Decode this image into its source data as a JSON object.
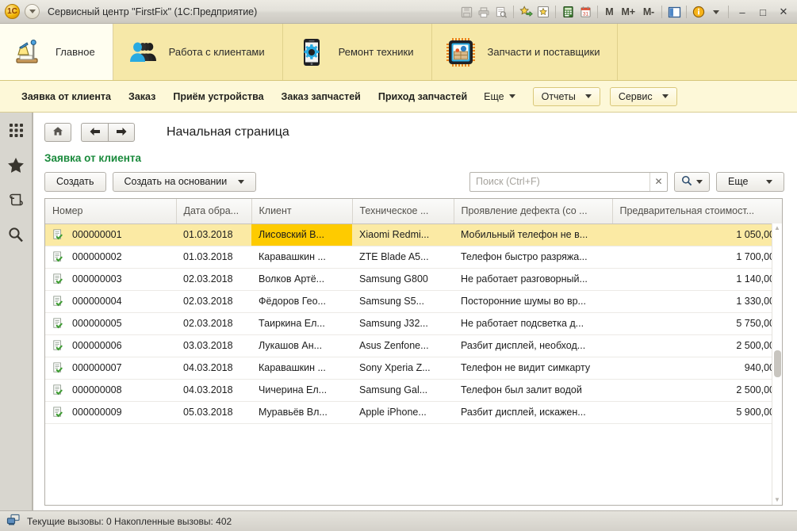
{
  "window": {
    "title": "Сервисный центр \"FirstFix\"  (1С:Предприятие)",
    "app_icon": "1c-logo-icon",
    "toolbar_icons": [
      "save-icon",
      "print-icon",
      "print-preview-icon",
      "add-favorite-icon",
      "favorites-icon",
      "calculator-icon",
      "calendar-icon"
    ],
    "memory_buttons": [
      "M",
      "M+",
      "M-"
    ],
    "panel_icon": "split-panel-icon",
    "info_icon": "info-icon",
    "minimize": "–",
    "maximize": "□",
    "close": "✕"
  },
  "sections": [
    {
      "label": "Главное",
      "icon": "desk-lamp-icon",
      "active": true
    },
    {
      "label": "Работа с клиентами",
      "icon": "people-icon",
      "active": false
    },
    {
      "label": "Ремонт техники",
      "icon": "phone-gear-icon",
      "active": false
    },
    {
      "label": "Запчасти и поставщики",
      "icon": "chip-parts-icon",
      "active": false
    }
  ],
  "command_bar": {
    "links": [
      "Заявка от клиента",
      "Заказ",
      "Приём устройства",
      "Заказ запчастей",
      "Приход запчастей"
    ],
    "more_label": "Еще",
    "buttons": [
      "Отчеты",
      "Сервис"
    ]
  },
  "sidebar": {
    "items": [
      {
        "name": "all-functions-icon",
        "label": "Все функции"
      },
      {
        "name": "favorites-star-icon",
        "label": "Избранное"
      },
      {
        "name": "history-icon",
        "label": "История"
      },
      {
        "name": "search-icon",
        "label": "Поиск"
      }
    ]
  },
  "nav": {
    "home_icon": "home-icon",
    "back_icon": "arrow-left-icon",
    "forward_icon": "arrow-right-icon",
    "page_title": "Начальная страница"
  },
  "form": {
    "title": "Заявка от клиента",
    "create_label": "Создать",
    "create_based_label": "Создать на основании",
    "more_label": "Еще",
    "search": {
      "placeholder": "Поиск (Ctrl+F)",
      "value": "",
      "clear_icon": "close-icon",
      "search_icon": "magnifier-icon"
    }
  },
  "table": {
    "columns": [
      "Номер",
      "Дата обра...",
      "Клиент",
      "Техническое ...",
      "Проявление дефекта (со ...",
      "Предварительная стоимост..."
    ],
    "rows": [
      {
        "icon": "document-check-icon",
        "number": "000000001",
        "date": "01.03.2018",
        "client": "Лисовский В...",
        "device": "Xiaomi Redmi...",
        "defect": "Мобильный телефон не в...",
        "cost": "1 050,00",
        "selected": true
      },
      {
        "icon": "document-check-icon",
        "number": "000000002",
        "date": "01.03.2018",
        "client": "Каравашкин ...",
        "device": "ZTE Blade A5...",
        "defect": "Телефон быстро разряжа...",
        "cost": "1 700,00",
        "selected": false
      },
      {
        "icon": "document-check-icon",
        "number": "000000003",
        "date": "02.03.2018",
        "client": "Волков Артё...",
        "device": "Samsung G800",
        "defect": "Не работает разговорный...",
        "cost": "1 140,00",
        "selected": false
      },
      {
        "icon": "document-check-icon",
        "number": "000000004",
        "date": "02.03.2018",
        "client": "Фёдоров Гео...",
        "device": "Samsung S5...",
        "defect": "Посторонние шумы во вр...",
        "cost": "1 330,00",
        "selected": false
      },
      {
        "icon": "document-check-icon",
        "number": "000000005",
        "date": "02.03.2018",
        "client": "Таиркина Ел...",
        "device": "Samsung J32...",
        "defect": "Не работает подсветка д...",
        "cost": "5 750,00",
        "selected": false
      },
      {
        "icon": "document-check-icon",
        "number": "000000006",
        "date": "03.03.2018",
        "client": "Лукашов Ан...",
        "device": "Asus Zenfone...",
        "defect": "Разбит дисплей, необход...",
        "cost": "2 500,00",
        "selected": false
      },
      {
        "icon": "document-check-icon",
        "number": "000000007",
        "date": "04.03.2018",
        "client": "Каравашкин ...",
        "device": "Sony Xperia Z...",
        "defect": "Телефон не видит симкарту",
        "cost": "940,00",
        "selected": false
      },
      {
        "icon": "document-check-icon",
        "number": "000000008",
        "date": "04.03.2018",
        "client": "Чичерина Ел...",
        "device": "Samsung Gal...",
        "defect": "Телефон был залит водой",
        "cost": "2 500,00",
        "selected": false
      },
      {
        "icon": "document-check-icon",
        "number": "000000009",
        "date": "05.03.2018",
        "client": "Муравьёв Вл...",
        "device": "Apple iPhone...",
        "defect": "Разбит дисплей, искажен...",
        "cost": "5 900,00",
        "selected": false
      }
    ]
  },
  "status_bar": {
    "icon": "network-calls-icon",
    "text": "Текущие вызовы: 0   Накопленные вызовы: 402"
  },
  "colors": {
    "ribbon_bg": "#f6e8a8",
    "cmdbar_bg": "#fdf8d8",
    "selected_row": "#fbeaa4",
    "focused_cell": "#fecb00",
    "form_title": "#1a8a3c"
  }
}
